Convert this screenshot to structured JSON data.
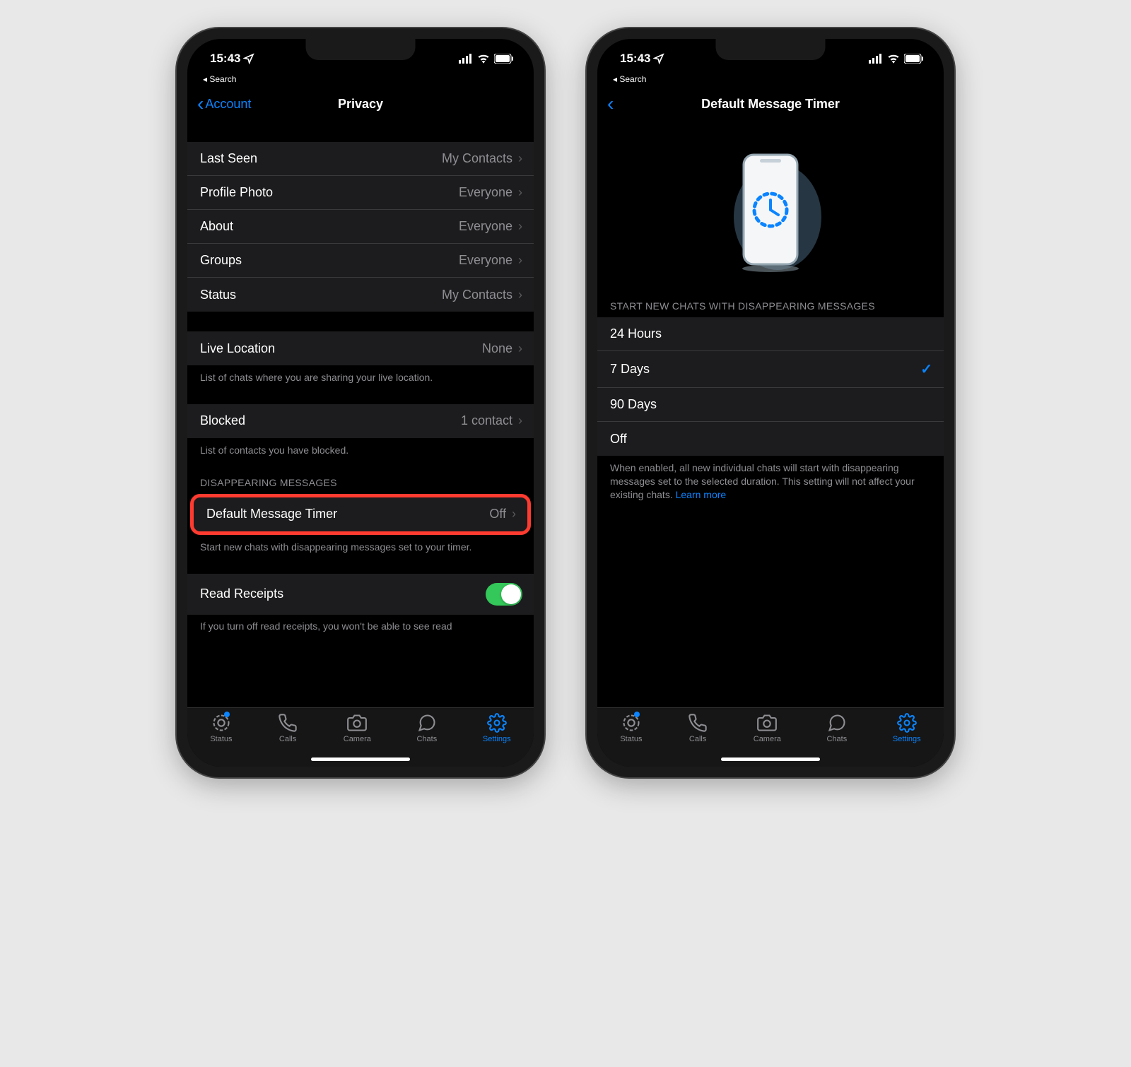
{
  "statusbar": {
    "time": "15:43",
    "breadcrumb": "◂ Search"
  },
  "left": {
    "nav": {
      "back": "Account",
      "title": "Privacy"
    },
    "group1": [
      {
        "label": "Last Seen",
        "value": "My Contacts"
      },
      {
        "label": "Profile Photo",
        "value": "Everyone"
      },
      {
        "label": "About",
        "value": "Everyone"
      },
      {
        "label": "Groups",
        "value": "Everyone"
      },
      {
        "label": "Status",
        "value": "My Contacts"
      }
    ],
    "live_location": {
      "label": "Live Location",
      "value": "None",
      "footer": "List of chats where you are sharing your live location."
    },
    "blocked": {
      "label": "Blocked",
      "value": "1 contact",
      "footer": "List of contacts you have blocked."
    },
    "disappearing": {
      "header": "DISAPPEARING MESSAGES",
      "label": "Default Message Timer",
      "value": "Off",
      "footer": "Start new chats with disappearing messages set to your timer."
    },
    "read_receipts": {
      "label": "Read Receipts",
      "truncated": "If you turn off read receipts, you won't be able to see read"
    }
  },
  "right": {
    "nav": {
      "title": "Default Message Timer"
    },
    "header": "START NEW CHATS WITH DISAPPEARING MESSAGES",
    "options": [
      {
        "label": "24 Hours",
        "selected": false
      },
      {
        "label": "7 Days",
        "selected": true
      },
      {
        "label": "90 Days",
        "selected": false
      },
      {
        "label": "Off",
        "selected": false
      }
    ],
    "footer_text": "When enabled, all new individual chats will start with disappearing messages set to the selected duration. This setting will not affect your existing chats. ",
    "learn_more": "Learn more"
  },
  "tabs": {
    "status": "Status",
    "calls": "Calls",
    "camera": "Camera",
    "chats": "Chats",
    "settings": "Settings"
  }
}
